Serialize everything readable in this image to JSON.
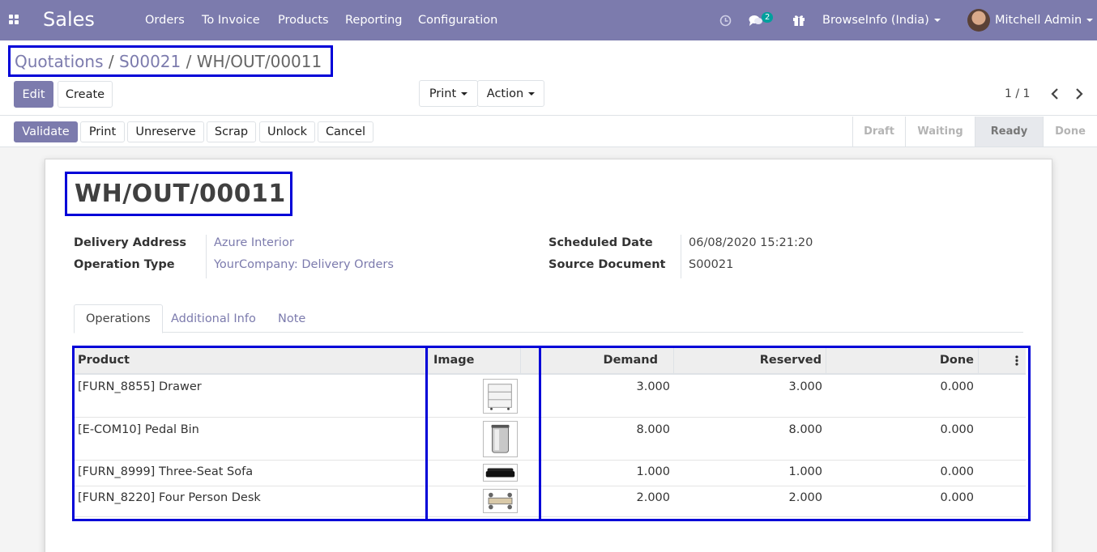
{
  "navbar": {
    "app_name": "Sales",
    "menu": [
      "Orders",
      "To Invoice",
      "Products",
      "Reporting",
      "Configuration"
    ],
    "message_count": "2",
    "company": "BrowseInfo (India)",
    "user": "Mitchell Admin"
  },
  "breadcrumb": [
    "Quotations",
    "S00021",
    "WH/OUT/00011"
  ],
  "control": {
    "edit": "Edit",
    "create": "Create",
    "print": "Print",
    "action": "Action",
    "pager": "1 / 1"
  },
  "statusbar": {
    "buttons": [
      "Validate",
      "Print",
      "Unreserve",
      "Scrap",
      "Unlock",
      "Cancel"
    ],
    "stages": [
      "Draft",
      "Waiting",
      "Ready",
      "Done"
    ],
    "current_stage": "Ready"
  },
  "record": {
    "name": "WH/OUT/00011",
    "fields": {
      "delivery_address_label": "Delivery Address",
      "delivery_address": "Azure Interior",
      "operation_type_label": "Operation Type",
      "operation_type": "YourCompany: Delivery Orders",
      "scheduled_date_label": "Scheduled Date",
      "scheduled_date": "06/08/2020 15:21:20",
      "source_document_label": "Source Document",
      "source_document": "S00021"
    }
  },
  "tabs": [
    "Operations",
    "Additional Info",
    "Note"
  ],
  "table": {
    "columns": [
      "Product",
      "Image",
      "Demand",
      "Reserved",
      "Done"
    ],
    "rows": [
      {
        "product": "[FURN_8855] Drawer",
        "demand": "3.000",
        "reserved": "3.000",
        "done": "0.000"
      },
      {
        "product": "[E-COM10] Pedal Bin",
        "demand": "8.000",
        "reserved": "8.000",
        "done": "0.000"
      },
      {
        "product": "[FURN_8999] Three-Seat Sofa",
        "demand": "1.000",
        "reserved": "1.000",
        "done": "0.000"
      },
      {
        "product": "[FURN_8220] Four Person Desk",
        "demand": "2.000",
        "reserved": "2.000",
        "done": "0.000"
      }
    ]
  },
  "colors": {
    "brand": "#7c7bad",
    "highlight": "#0000d8"
  }
}
